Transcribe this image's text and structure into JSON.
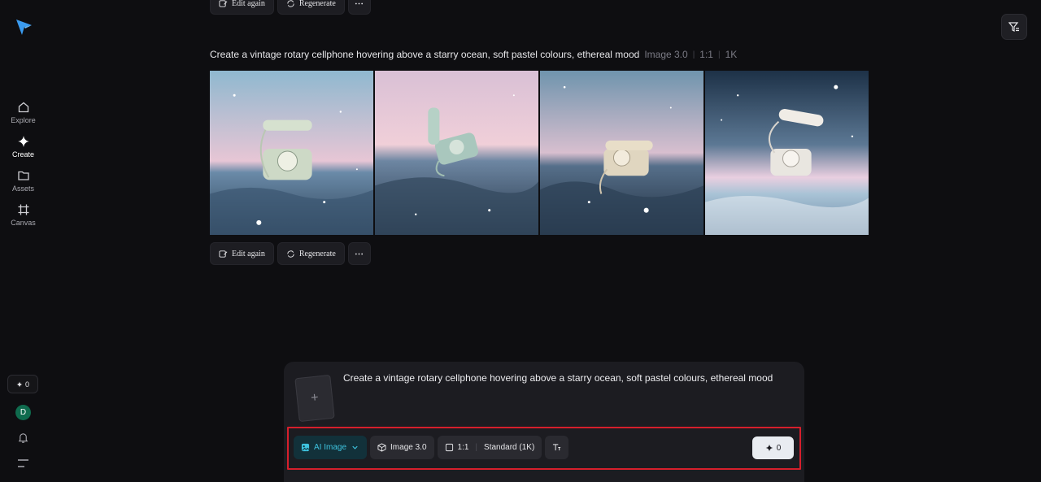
{
  "sidebar": {
    "nav": [
      {
        "label": "Explore",
        "icon": "home-icon"
      },
      {
        "label": "Create",
        "icon": "sparkle-icon"
      },
      {
        "label": "Assets",
        "icon": "folder-icon"
      },
      {
        "label": "Canvas",
        "icon": "canvas-icon"
      }
    ],
    "credits": "0",
    "avatar_initial": "D"
  },
  "top_actions": {
    "edit_again": "Edit again",
    "regenerate": "Regenerate"
  },
  "result": {
    "prompt": "Create a vintage rotary cellphone hovering above a starry ocean, soft pastel colours, ethereal mood",
    "model": "Image 3.0",
    "ratio": "1:1",
    "resolution": "1K",
    "images": [
      "generated-image-1",
      "generated-image-2",
      "generated-image-3",
      "generated-image-4"
    ]
  },
  "actions": {
    "edit_again": "Edit again",
    "regenerate": "Regenerate"
  },
  "composer": {
    "prompt": "Create a vintage rotary cellphone hovering above a starry ocean, soft pastel colours, ethereal mood",
    "upload_plus": "+",
    "mode": "AI Image",
    "model": "Image 3.0",
    "ratio": "1:1",
    "quality": "Standard (1K)",
    "generate_cost": "0"
  },
  "colors": {
    "accent": "#3ec3df",
    "highlight_frame": "#d61f2c",
    "background": "#0e0e11"
  }
}
